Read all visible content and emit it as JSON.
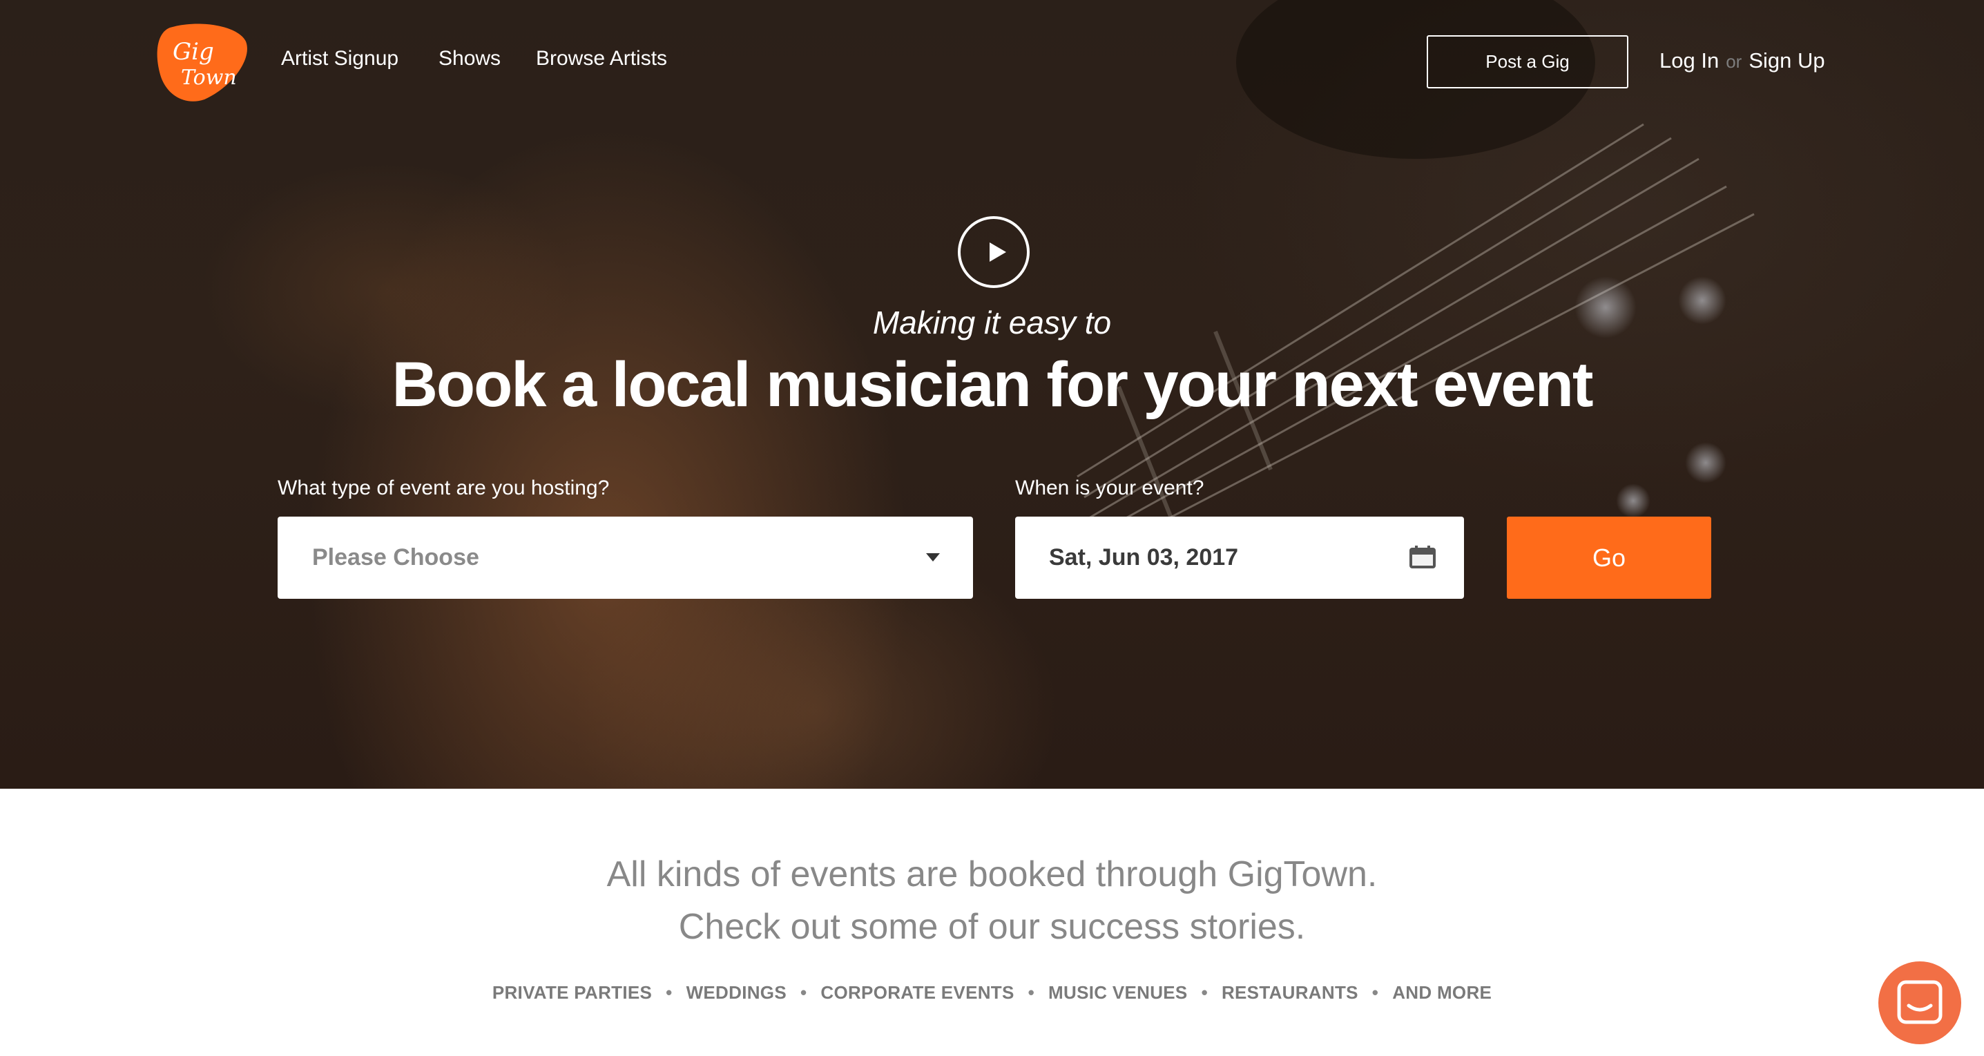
{
  "header": {
    "logo_text_line1": "Gig",
    "logo_text_line2": "Town",
    "nav": [
      {
        "label": "Artist Signup"
      },
      {
        "label": "Shows"
      },
      {
        "label": "Browse Artists"
      }
    ],
    "post_gig_label": "Post a Gig",
    "login_label": "Log In",
    "or_label": "or",
    "signup_label": "Sign Up"
  },
  "hero": {
    "subheading": "Making it easy to",
    "headline": "Book a local musician for your next event",
    "event_type_label": "What type of event are you hosting?",
    "event_type_value": "Please Choose",
    "event_date_label": "When is your event?",
    "event_date_value": "Sat, Jun 03, 2017",
    "go_label": "Go"
  },
  "stories": {
    "line1": "All kinds of events are booked through GigTown.",
    "line2": "Check out some of our success stories.",
    "categories": [
      "PRIVATE PARTIES",
      "WEDDINGS",
      "CORPORATE EVENTS",
      "MUSIC VENUES",
      "RESTAURANTS",
      "AND MORE"
    ]
  },
  "colors": {
    "accent": "#ff6b1a",
    "chat_bubble": "#f26f45",
    "hero_bg": "#2b2019"
  },
  "icons": {
    "play": "play-icon",
    "dropdown": "chevron-down-icon",
    "calendar": "calendar-icon",
    "chat": "chat-icon"
  }
}
